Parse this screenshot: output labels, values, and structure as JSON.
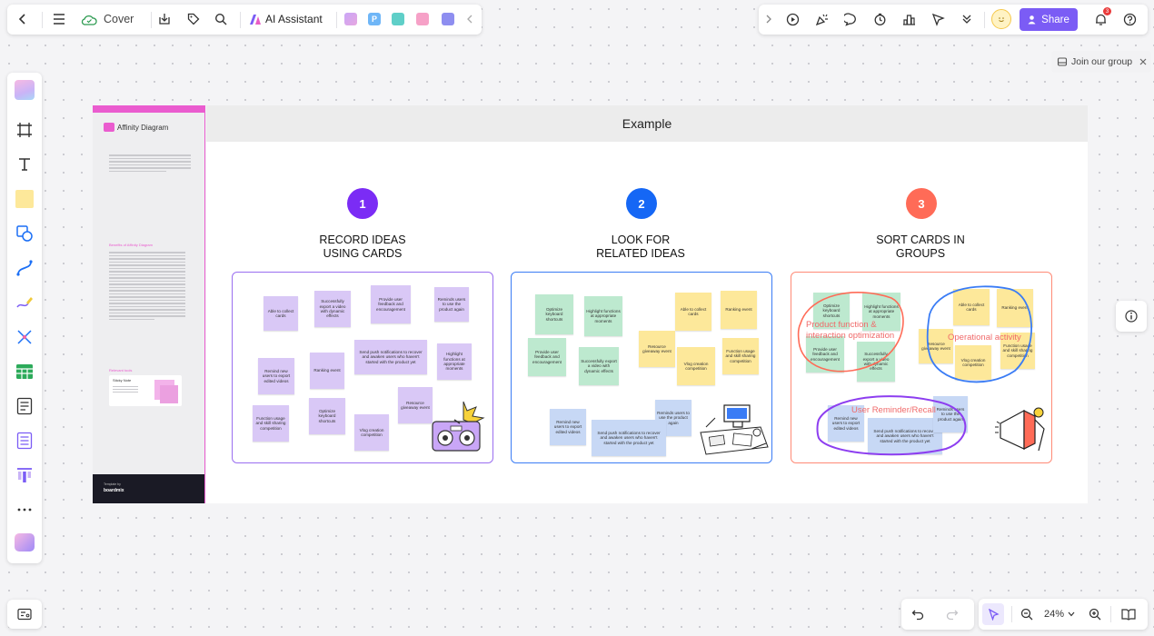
{
  "toolbar": {
    "doc_title": "Cover",
    "ai_label": "AI Assistant",
    "share_label": "Share",
    "notif_count": "3"
  },
  "banner": {
    "join_label": "Join our group"
  },
  "frame": {
    "title": "Example"
  },
  "template": {
    "title": "Affinity Diagram",
    "section1": "Benefits of Affinity Diagram",
    "section2": "Relevant tools",
    "tool_title": "Sticky Note",
    "footer_small": "Template by",
    "footer_brand": "boardmix"
  },
  "steps": [
    {
      "num": "1",
      "title_line1": "RECORD IDEAS",
      "title_line2": "USING CARDS",
      "color": "#7b2cf5"
    },
    {
      "num": "2",
      "title_line1": "LOOK FOR",
      "title_line2": "RELATED IDEAS",
      "color": "#1567f5"
    },
    {
      "num": "3",
      "title_line1": "SORT CARDS IN",
      "title_line2": "GROUPS",
      "color": "#ff6b57"
    }
  ],
  "cards1": [
    "Able to collect cards",
    "Successfully export a video with dynamic effects",
    "Provide user feedback and encouragement",
    "Reminds users to use the product again",
    "Remind new users to export edited videos",
    "Ranking event",
    "Send push notifications to recover and awaken users who haven't started with the product yet",
    "Highlight functions at appropriate moments",
    "Function usage and skill sharing competition",
    "Optimize keyboard shortcuts",
    "Vlog creation competition",
    "Resource giveaway event"
  ],
  "cards2": [
    "Optimize keyboard shortcuts",
    "Highlight functions at appropriate moments",
    "Able to collect cards",
    "Ranking event",
    "Provide user feedback and encouragement",
    "Successfully export a video with dynamic effects",
    "Resource giveaway event",
    "Vlog creation competition",
    "Function usage and skill sharing competition",
    "Remind new users to export edited videos",
    "Reminds users to use the product again",
    "Send push notifications to recover and awaken users who haven't started with the product yet"
  ],
  "cards3": [
    "Optimize keyboard shortcuts",
    "Highlight functions at appropriate moments",
    "Provide user feedback and encouragement",
    "Successfully export a video with dynamic effects",
    "Able to collect cards",
    "Ranking event",
    "Resource giveaway event",
    "Function usage and skill sharing competition",
    "Vlog creation competition",
    "Remind new users to export edited videos",
    "Send push notifications to recover and awaken users who haven't started with the product yet",
    "Reminds users to use the product again"
  ],
  "groups": {
    "g1": "Product function & interaction optimization",
    "g2": "Operational activity",
    "g3": "User Reminder/Recall"
  },
  "bottom": {
    "zoom": "24%"
  },
  "colors": {
    "accent": "#7b5cf5",
    "pink": "#ea5ccf",
    "orange": "#ff6b57"
  }
}
